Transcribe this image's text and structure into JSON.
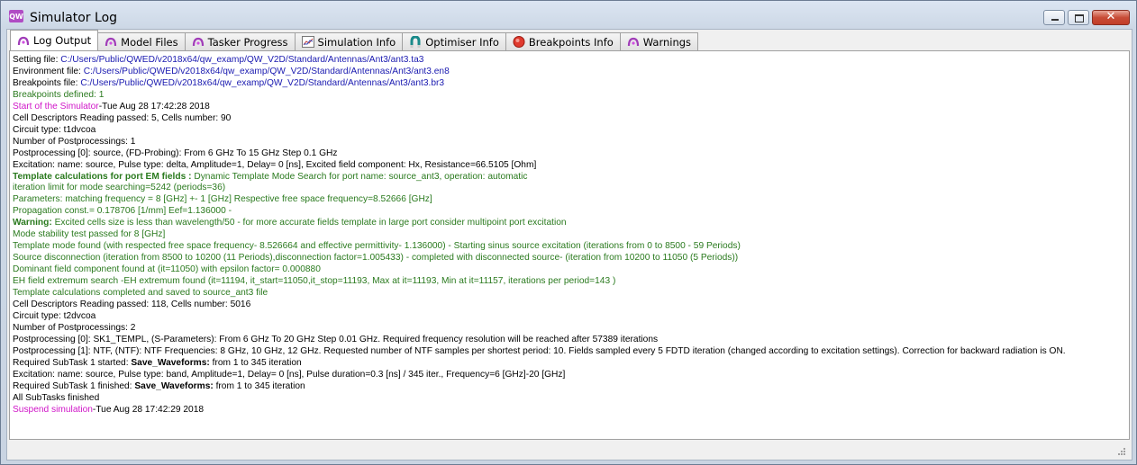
{
  "window": {
    "title": "Simulator Log"
  },
  "tabs": [
    {
      "label": "Log Output",
      "icon": "qw-icon",
      "active": true
    },
    {
      "label": "Model Files",
      "icon": "qw-icon"
    },
    {
      "label": "Tasker Progress",
      "icon": "qw-icon"
    },
    {
      "label": "Simulation Info",
      "icon": "chart-icon"
    },
    {
      "label": "Optimiser Info",
      "icon": "magnet-icon"
    },
    {
      "label": "Breakpoints Info",
      "icon": "stop-icon"
    },
    {
      "label": "Warnings",
      "icon": "qw-icon"
    }
  ],
  "log": {
    "l1": {
      "a": "Setting file: ",
      "b": "C:/Users/Public/QWED/v2018x64/qw_examp/QW_V2D/Standard/Antennas/Ant3/ant3.ta3"
    },
    "l2": {
      "a": "Environment file: ",
      "b": "C:/Users/Public/QWED/v2018x64/qw_examp/QW_V2D/Standard/Antennas/Ant3/ant3.en8"
    },
    "l3": {
      "a": "Breakpoints file: ",
      "b": "C:/Users/Public/QWED/v2018x64/qw_examp/QW_V2D/Standard/Antennas/Ant3/ant3.br3"
    },
    "l4": "Breakpoints defined: 1",
    "l5": {
      "a": "Start of the Simulator",
      "b": "-Tue Aug 28 17:42:28 2018"
    },
    "l6": "Cell Descriptors Reading passed: 5, Cells number: 90",
    "l7": "Circuit type: t1dvcoa",
    "l8": "Number of Postprocessings: 1",
    "l9": "Postprocessing [0]: source, (FD-Probing): From 6 GHz To 15 GHz Step 0.1 GHz",
    "l10": "Excitation: name: source, Pulse type: delta, Amplitude=1, Delay= 0 [ns], Excited field component: Hx, Resistance=66.5105 [Ohm]",
    "l11": {
      "a": "Template calculations for port EM fields :",
      "b": " Dynamic Template Mode Search for port name: source_ant3, operation: automatic"
    },
    "l12": "iteration limit for mode searching=5242 (periods=36)",
    "l13": "Parameters: matching frequency = 8 [GHz] +- 1 [GHz] Respective free space frequency=8.52666 [GHz]",
    "l14": "Propagation const.= 0.178706 [1/mm] Eef=1.136000 -",
    "l15": {
      "a": "Warning:",
      "b": " Excited cells size is less than wavelength/50 - for more accurate fields template in large port consider multipoint port excitation"
    },
    "l16": "Mode stability test passed for 8 [GHz]",
    "l17": "Template mode found (with respected free space frequency- 8.526664 and effective permittivity- 1.136000) - Starting sinus source excitation (iterations from 0 to 8500 - 59 Periods)",
    "l18": "Source disconnection (iteration from 8500 to 10200 (11 Periods),disconnection factor=1.005433) - completed with disconnected source- (iteration from 10200 to 11050 (5 Periods))",
    "l19": "Dominant field component found at (it=11050) with epsilon factor= 0.000880",
    "l20": "EH field extremum search -EH extremum found (it=11194, it_start=11050,it_stop=11193, Max at it=11193, Min at it=11157, iterations per period=143 )",
    "l21": "Template calculations completed and saved to source_ant3 file",
    "l22": "Cell Descriptors Reading passed: 118, Cells number: 5016",
    "l23": "Circuit type: t2dvcoa",
    "l24": "Number of Postprocessings: 2",
    "l25": "Postprocessing [0]: SK1_TEMPL, (S-Parameters): From 6 GHz To 20 GHz Step 0.01 GHz. Required frequency resolution will be reached after 57389 iterations",
    "l26": "Postprocessing [1]: NTF, (NTF): NTF Frequencies: 8 GHz, 10 GHz, 12 GHz. Requested number of NTF samples per shortest period: 10. Fields sampled every 5 FDTD iteration (changed according to excitation settings). Correction for backward radiation is ON.",
    "l27": {
      "a": "Required SubTask 1 started: ",
      "b": "Save_Waveforms:",
      "c": " from 1 to 345 iteration"
    },
    "l28": "Excitation: name: source, Pulse type: band, Amplitude=1, Delay= 0 [ns], Pulse duration=0.3 [ns] / 345 iter., Frequency=6 [GHz]-20 [GHz]",
    "l29": {
      "a": "Required SubTask 1 finished: ",
      "b": "Save_Waveforms:",
      "c": " from 1 to 345 iteration"
    },
    "l30": "All SubTasks finished",
    "l31": {
      "a": "Suspend simulation",
      "b": "-Tue Aug 28 17:42:29 2018"
    }
  },
  "colors": {
    "path": "#1a1ab0",
    "green": "#2a7a1e",
    "magenta": "#d016c8",
    "close": "#c84c37"
  }
}
